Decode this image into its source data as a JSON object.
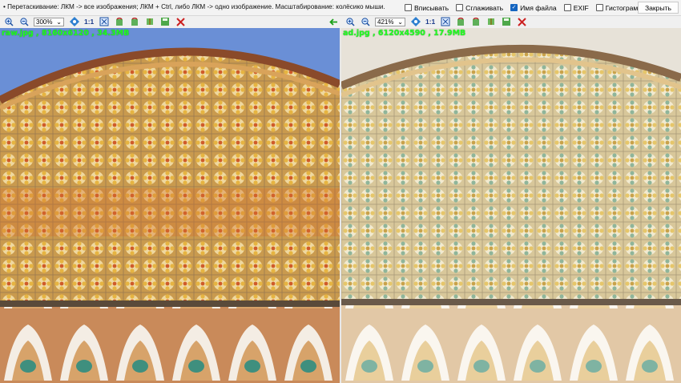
{
  "hint_text": "• Перетаскивание: ЛКМ -> все изображения; ЛКМ + Ctrl, либо ЛКМ -> одно изображение. Масштабирование: колёсико мыши.",
  "options": [
    {
      "label": "Вписывать",
      "checked": false
    },
    {
      "label": "Сглаживать",
      "checked": false
    },
    {
      "label": "Имя файла",
      "checked": true
    },
    {
      "label": "EXIF",
      "checked": false
    },
    {
      "label": "Гистограмма",
      "checked": false
    },
    {
      "label": "+",
      "checked": false
    }
  ],
  "close_label": "Закрыть",
  "left": {
    "zoom": "300%",
    "one_to_one": "1:1",
    "file_info": "raw.jpg , 8160x6120 , 34.3MB"
  },
  "right": {
    "zoom": "421%",
    "one_to_one": "1:1",
    "file_info": "ad.jpg , 6120x4590 , 17.9MB"
  },
  "colors": {
    "accent": "#1565c0",
    "file_text": "#22ff22",
    "delete_red": "#cc2020"
  },
  "icons": [
    "zoom-in-icon",
    "zoom-out-icon",
    "fit-icon",
    "actual-size-icon",
    "rotate-left-icon",
    "rotate-right-icon",
    "flip-icon",
    "save-icon",
    "delete-icon",
    "green-back-arrow-icon"
  ]
}
